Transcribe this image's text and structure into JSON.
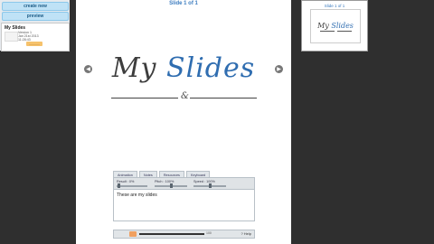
{
  "left_panel": {
    "create_button": "create new",
    "preview_button": "preview",
    "project": {
      "title": "My Slides",
      "meta_line1": "Version 1",
      "meta_line2": "Jan 21st 2013",
      "meta_line3": "11:28:43",
      "tag": "............"
    }
  },
  "slide": {
    "counter": "Slide 1 of 1",
    "title_part1": "My",
    "title_part2": "Slides",
    "ornament": "&"
  },
  "notes_panel": {
    "tabs": [
      "Animation",
      "Notes",
      "Resources",
      "Keyboard"
    ],
    "toolbar": {
      "result_label": "Result : 0%",
      "pitch_label": "Pitch : 100%",
      "speed_label": "Speed : 100%"
    },
    "note_text": "These are my slides",
    "help_label": "? Help",
    "volume_label": "100"
  },
  "thumbnail": {
    "counter": "Slide 1 of 1",
    "title_part1": "My",
    "title_part2": "Slides"
  },
  "colors": {
    "accent_blue": "#2f6db0",
    "button_blue": "#bfe2f6",
    "tag_orange": "#f6c26c",
    "background": "#2f2f2f"
  }
}
